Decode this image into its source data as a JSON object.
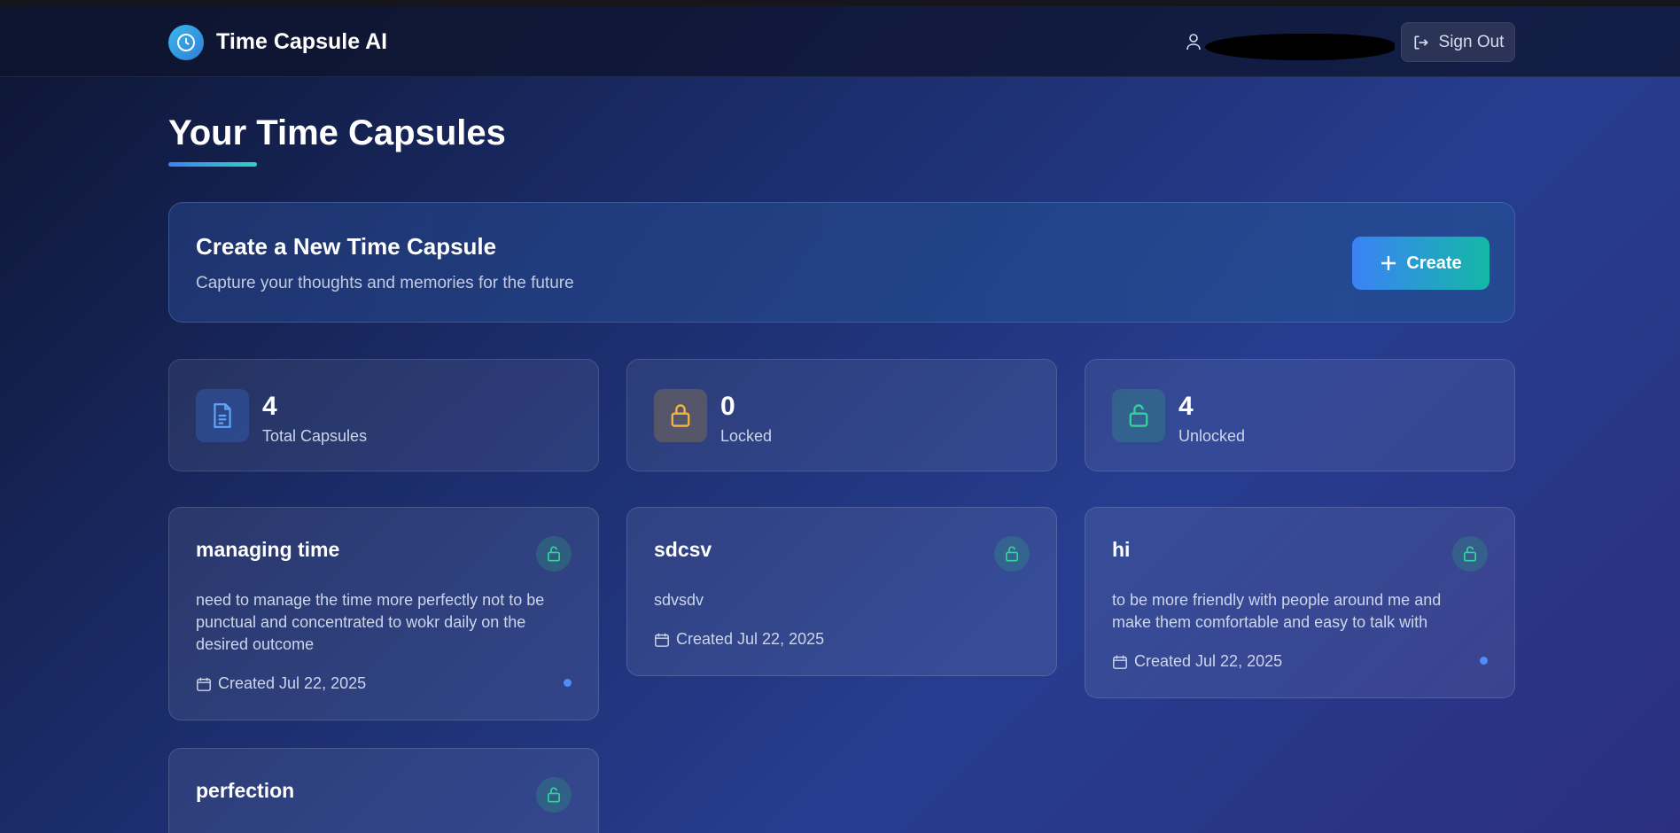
{
  "header": {
    "app_title": "Time Capsule AI",
    "sign_out_label": "Sign Out"
  },
  "page": {
    "title": "Your Time Capsules"
  },
  "create_card": {
    "title": "Create a New Time Capsule",
    "subtitle": "Capture your thoughts and memories for the future",
    "button_label": "Create"
  },
  "stats": [
    {
      "value": "4",
      "label": "Total Capsules",
      "icon": "document-icon",
      "color": "#60a5fa"
    },
    {
      "value": "0",
      "label": "Locked",
      "icon": "lock-icon",
      "color": "#f5b53d"
    },
    {
      "value": "4",
      "label": "Unlocked",
      "icon": "unlock-icon",
      "color": "#34d399"
    }
  ],
  "capsules": [
    {
      "title": "managing time",
      "body": "need to manage the time more perfectly not to be punctual and concentrated to wokr daily on the desired outcome",
      "date": "Created Jul 22, 2025",
      "status": "unlocked",
      "has_dot": true
    },
    {
      "title": "sdcsv",
      "body": "sdvsdv",
      "date": "Created Jul 22, 2025",
      "status": "unlocked",
      "has_dot": false
    },
    {
      "title": "hi",
      "body": "to be more friendly with people around me and make them comfortable and easy to talk with",
      "date": "Created Jul 22, 2025",
      "status": "unlocked",
      "has_dot": true
    },
    {
      "title": "perfection",
      "status": "unlocked"
    }
  ],
  "colors": {
    "accent_blue": "#3b82f6",
    "accent_teal": "#14b8a6",
    "unlocked_green": "#34d399",
    "dot_blue": "#4f8ef7"
  }
}
